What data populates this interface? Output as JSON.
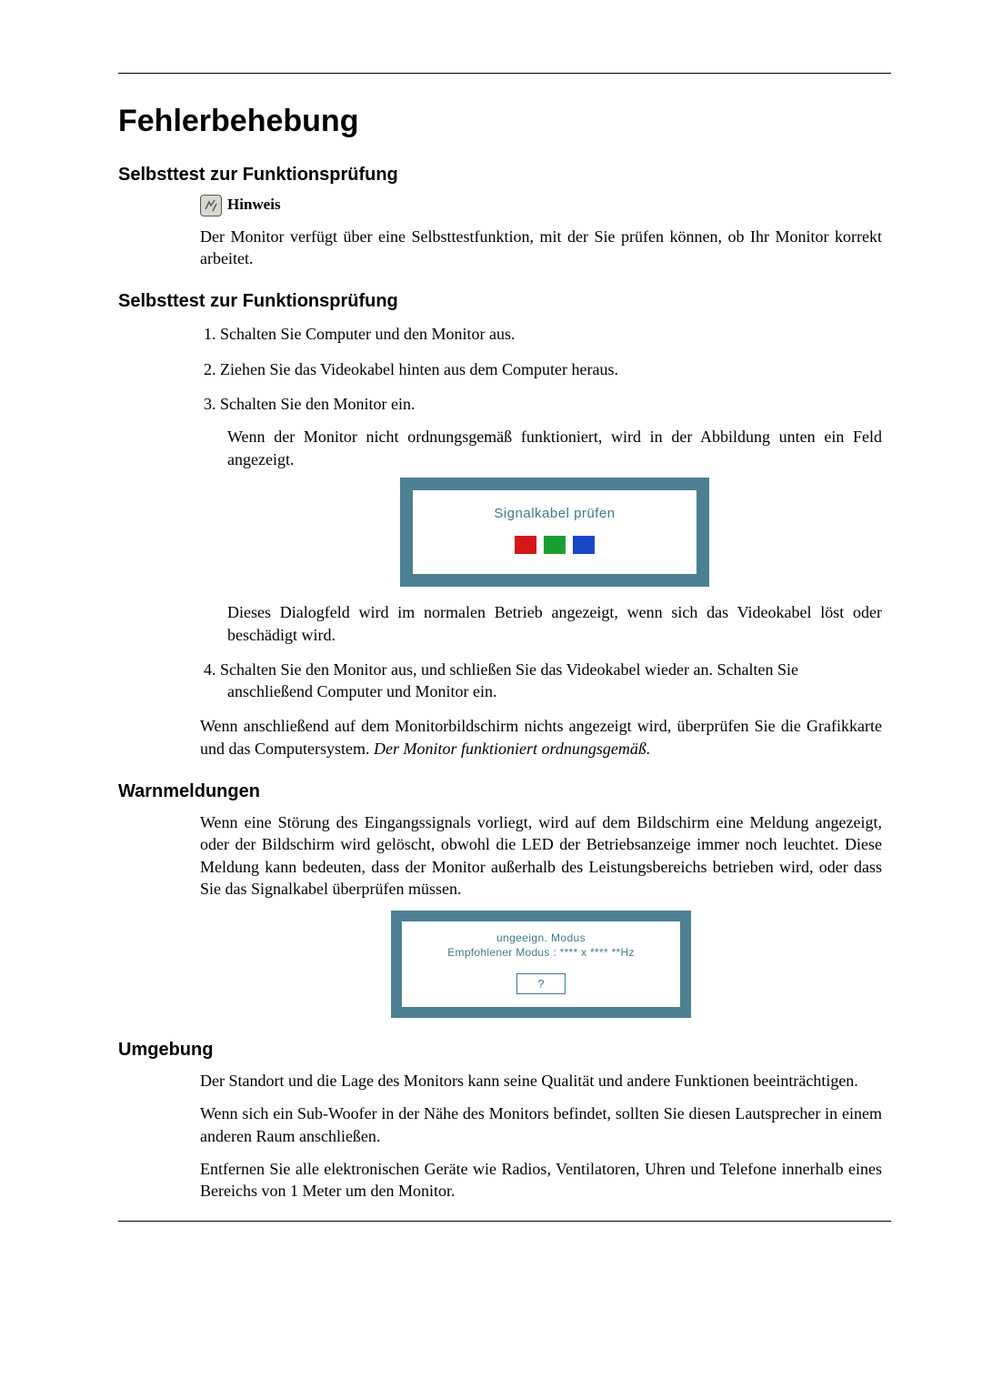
{
  "title": "Fehlerbehebung",
  "section1": {
    "heading": "Selbsttest zur Funktionsprüfung",
    "noteLabel": "Hinweis",
    "noteBody": "Der Monitor verfügt über eine Selbsttestfunktion, mit der Sie prüfen können, ob Ihr Monitor korrekt arbeitet."
  },
  "section2": {
    "heading": "Selbsttest zur Funktionsprüfung",
    "steps": {
      "s1": "Schalten Sie Computer und den Monitor aus.",
      "s2": "Ziehen Sie das Videokabel hinten aus dem Computer heraus.",
      "s3": "Schalten Sie den Monitor ein.",
      "s3b": "Wenn der Monitor nicht ordnungsgemäß funktioniert, wird in der Abbildung unten ein Feld angezeigt.",
      "s3c": "Dieses Dialogfeld wird im normalen Betrieb angezeigt, wenn sich das Videokabel löst oder beschädigt wird.",
      "s4": "Schalten Sie den Monitor aus, und schließen Sie das Videokabel wieder an. Schalten Sie anschließend Computer und Monitor ein."
    },
    "follow1": "Wenn anschließend auf dem Monitorbildschirm nichts angezeigt wird, überprüfen Sie die Grafikkarte und das Computersystem. ",
    "follow1i": "Der Monitor funktioniert ordnungsgemäß.",
    "dialog": {
      "text": "Signalkabel prüfen"
    }
  },
  "section3": {
    "heading": "Warnmeldungen",
    "body": "Wenn eine Störung des Eingangssignals vorliegt, wird auf dem Bildschirm eine Meldung angezeigt, oder der Bildschirm wird gelöscht, obwohl die LED der Betriebsanzeige immer noch leuchtet. Diese Meldung kann bedeuten, dass der Monitor außerhalb des Leistungsbereichs betrieben wird, oder dass Sie das Signalkabel überprüfen müssen.",
    "dialog": {
      "line1": "ungeeign. Modus",
      "line2": "Empfohlener Modus :  **** x ****  **Hz",
      "button": "?"
    }
  },
  "section4": {
    "heading": "Umgebung",
    "p1": "Der Standort und die Lage des Monitors kann seine Qualität und andere Funktionen beeinträchtigen.",
    "p2": "Wenn sich ein Sub-Woofer in der Nähe des Monitors befindet, sollten Sie diesen Lautsprecher in einem anderen Raum anschließen.",
    "p3": "Entfernen Sie alle elektronischen Geräte wie Radios, Ventilatoren, Uhren und Telefone innerhalb eines Bereichs von 1 Meter um den Monitor."
  }
}
